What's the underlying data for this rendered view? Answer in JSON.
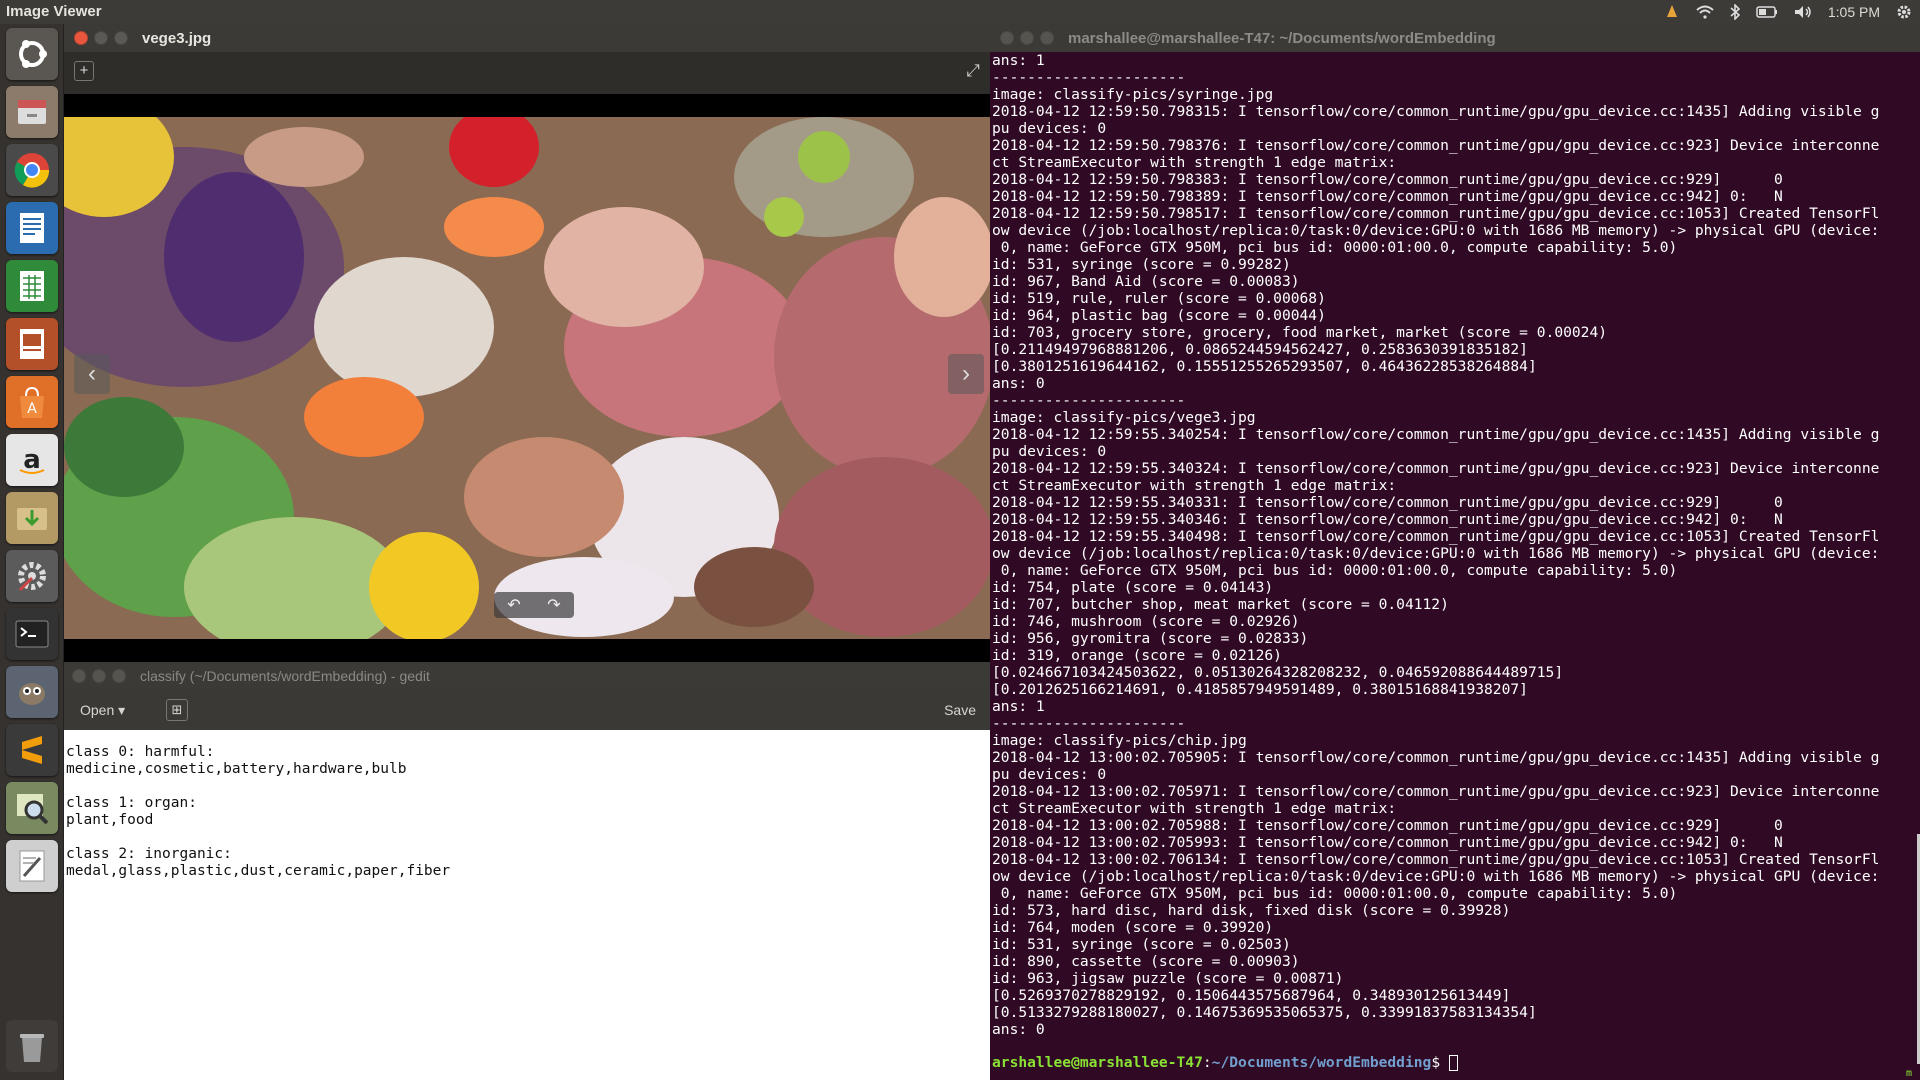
{
  "topbar": {
    "app_title": "Image Viewer",
    "clock": "1:05 PM"
  },
  "launcher": [
    {
      "name": "ubuntu-dash-icon"
    },
    {
      "name": "files-icon"
    },
    {
      "name": "chrome-icon"
    },
    {
      "name": "writer-icon"
    },
    {
      "name": "calc-icon"
    },
    {
      "name": "impress-icon"
    },
    {
      "name": "software-center-icon"
    },
    {
      "name": "amazon-icon"
    },
    {
      "name": "downloads-icon"
    },
    {
      "name": "system-settings-icon"
    },
    {
      "name": "terminal-icon"
    },
    {
      "name": "gimp-icon"
    },
    {
      "name": "sublime-text-icon"
    },
    {
      "name": "image-viewer-icon"
    },
    {
      "name": "text-editor-icon"
    },
    {
      "name": "trash-icon"
    }
  ],
  "image_viewer": {
    "title": "vege3.jpg"
  },
  "gedit": {
    "title": "classify (~/Documents/wordEmbedding) - gedit",
    "open_label": "Open",
    "save_label": "Save",
    "text": "class 0: harmful:\nmedicine,cosmetic,battery,hardware,bulb\n\nclass 1: organ:\nplant,food\n\nclass 2: inorganic:\nmedal,glass,plastic,dust,ceramic,paper,fiber"
  },
  "terminal": {
    "title": "marshallee@marshallee-T47: ~/Documents/wordEmbedding",
    "output": "ans: 1\n----------------------\nimage: classify-pics/syringe.jpg\n2018-04-12 12:59:50.798315: I tensorflow/core/common_runtime/gpu/gpu_device.cc:1435] Adding visible g\npu devices: 0\n2018-04-12 12:59:50.798376: I tensorflow/core/common_runtime/gpu/gpu_device.cc:923] Device interconne\nct StreamExecutor with strength 1 edge matrix:\n2018-04-12 12:59:50.798383: I tensorflow/core/common_runtime/gpu/gpu_device.cc:929]      0\n2018-04-12 12:59:50.798389: I tensorflow/core/common_runtime/gpu/gpu_device.cc:942] 0:   N\n2018-04-12 12:59:50.798517: I tensorflow/core/common_runtime/gpu/gpu_device.cc:1053] Created TensorFl\now device (/job:localhost/replica:0/task:0/device:GPU:0 with 1686 MB memory) -> physical GPU (device:\n 0, name: GeForce GTX 950M, pci bus id: 0000:01:00.0, compute capability: 5.0)\nid: 531, syringe (score = 0.99282)\nid: 967, Band Aid (score = 0.00083)\nid: 519, rule, ruler (score = 0.00068)\nid: 964, plastic bag (score = 0.00044)\nid: 703, grocery store, grocery, food market, market (score = 0.00024)\n[0.21149497968881206, 0.0865244594562427, 0.2583630391835182]\n[0.3801251619644162, 0.15551255265293507, 0.46436228538264884]\nans: 0\n----------------------\nimage: classify-pics/vege3.jpg\n2018-04-12 12:59:55.340254: I tensorflow/core/common_runtime/gpu/gpu_device.cc:1435] Adding visible g\npu devices: 0\n2018-04-12 12:59:55.340324: I tensorflow/core/common_runtime/gpu/gpu_device.cc:923] Device interconne\nct StreamExecutor with strength 1 edge matrix:\n2018-04-12 12:59:55.340331: I tensorflow/core/common_runtime/gpu/gpu_device.cc:929]      0\n2018-04-12 12:59:55.340346: I tensorflow/core/common_runtime/gpu/gpu_device.cc:942] 0:   N\n2018-04-12 12:59:55.340498: I tensorflow/core/common_runtime/gpu/gpu_device.cc:1053] Created TensorFl\now device (/job:localhost/replica:0/task:0/device:GPU:0 with 1686 MB memory) -> physical GPU (device:\n 0, name: GeForce GTX 950M, pci bus id: 0000:01:00.0, compute capability: 5.0)\nid: 754, plate (score = 0.04143)\nid: 707, butcher shop, meat market (score = 0.04112)\nid: 746, mushroom (score = 0.02926)\nid: 956, gyromitra (score = 0.02833)\nid: 319, orange (score = 0.02126)\n[0.024667103424503622, 0.05130264328208232, 0.046592088644489715]\n[0.2012625166214691, 0.4185857949591489, 0.38015168841938207]\nans: 1\n----------------------\nimage: classify-pics/chip.jpg\n2018-04-12 13:00:02.705905: I tensorflow/core/common_runtime/gpu/gpu_device.cc:1435] Adding visible g\npu devices: 0\n2018-04-12 13:00:02.705971: I tensorflow/core/common_runtime/gpu/gpu_device.cc:923] Device interconne\nct StreamExecutor with strength 1 edge matrix:\n2018-04-12 13:00:02.705988: I tensorflow/core/common_runtime/gpu/gpu_device.cc:929]      0\n2018-04-12 13:00:02.705993: I tensorflow/core/common_runtime/gpu/gpu_device.cc:942] 0:   N\n2018-04-12 13:00:02.706134: I tensorflow/core/common_runtime/gpu/gpu_device.cc:1053] Created TensorFl\now device (/job:localhost/replica:0/task:0/device:GPU:0 with 1686 MB memory) -> physical GPU (device:\n 0, name: GeForce GTX 950M, pci bus id: 0000:01:00.0, compute capability: 5.0)\nid: 573, hard disc, hard disk, fixed disk (score = 0.39928)\nid: 764, moden (score = 0.39920)\nid: 531, syringe (score = 0.02503)\nid: 890, cassette (score = 0.00903)\nid: 963, jigsaw puzzle (score = 0.00871)\n[0.5269370278829192, 0.1506443575687964, 0.348930125613449]\n[0.5133279288180027, 0.14675369535065375, 0.33991837583134354]\nans: 0",
    "prompt_user": "arshallee@marshallee-T47",
    "prompt_path": "~/Documents/wordEmbedding",
    "prompt_symbol": "$ "
  }
}
